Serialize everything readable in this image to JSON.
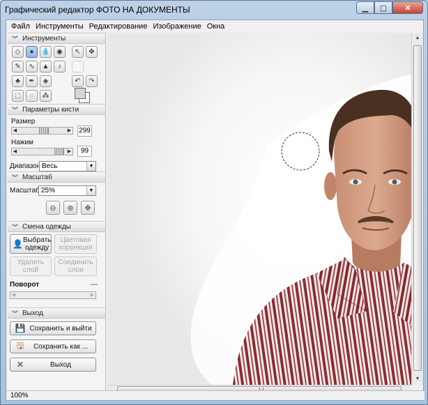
{
  "window": {
    "title": "Графический редактор ФОТО НА ДОКУМЕНТЫ"
  },
  "menu": [
    "Файл",
    "Инструменты",
    "Редактирование",
    "Изображение",
    "Окна"
  ],
  "sections": {
    "tools": "Инструменты",
    "brush": "Параметры кисти",
    "zoom": "Масштаб",
    "clothes": "Смена одежды",
    "exit": "Выход"
  },
  "brush": {
    "size_label": "Размер",
    "size_value": "299",
    "size_fraction": 0.55,
    "pressure_label": "Нажим",
    "pressure_value": "99",
    "pressure_fraction": 0.95,
    "range_label": "Диапазон",
    "range_value": "Весь"
  },
  "zoom": {
    "label": "Масштаб",
    "value": "25%"
  },
  "clothes": {
    "choose": "Выбрать одежду",
    "color": "Цветовая коррекция",
    "delete_layer": "Удалить слой",
    "merge_layers": "Соединить слои",
    "rotation_label": "Поворот",
    "rotation_value": "---"
  },
  "exit": {
    "save_exit": "Сохранить и выйти",
    "save_as": "Сохранить как ...",
    "quit": "Выход"
  },
  "status": {
    "zoom": "100%"
  }
}
